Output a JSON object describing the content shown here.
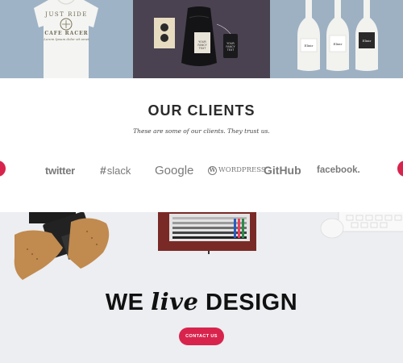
{
  "gallery": {
    "tshirt": {
      "line1": "JUST RIDE",
      "line2": "CAFE RACER",
      "line3": "Lorem Ipsum dolor sit amet"
    },
    "tags": {
      "label1": "YOUR FANCY TEXT",
      "label2": "YOUR FANCY TEXT"
    },
    "bottles": {
      "label": "Elixir"
    }
  },
  "clients": {
    "title": "OUR CLIENTS",
    "subtitle": "These are some of our clients. They trust us.",
    "logos": {
      "twitter": "twitter",
      "slack": "slack",
      "slack_hash": "#",
      "google": "Google",
      "wordpress_mark": "W",
      "wordpress": "WORDPRESS",
      "github": "GitHub",
      "facebook": "facebook."
    }
  },
  "hero": {
    "title_we": "WE",
    "title_live": "live",
    "title_design": "DESIGN",
    "cta_label": "CONTACT US"
  },
  "colors": {
    "accent": "#d8244c",
    "logo_gray": "#7a7a7a"
  }
}
